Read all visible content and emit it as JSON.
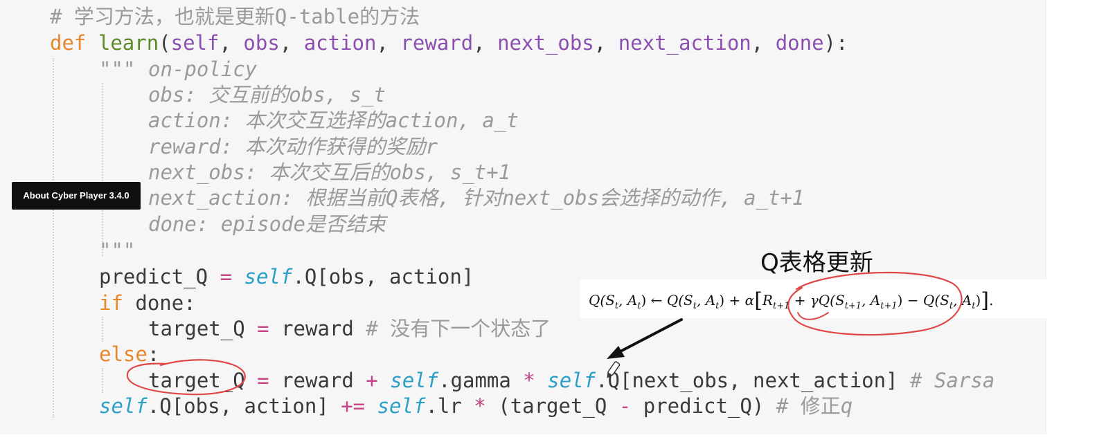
{
  "code": {
    "comment_header": "# 学习方法，也就是更新Q-table的方法",
    "def_line": {
      "def_kw": "def",
      "fn_name": "learn",
      "open": "(",
      "params": [
        "self",
        "obs",
        "action",
        "reward",
        "next_obs",
        "next_action",
        "done"
      ],
      "sep": ", ",
      "close": "):"
    },
    "docstring_quote": "\"\"\"",
    "docstring_lines": [
      "on-policy",
      "obs: 交互前的obs, s_t",
      "action: 本次交互选择的action, a_t",
      "reward: 本次动作获得的奖励r",
      "next_obs: 本次交互后的obs, s_t+1",
      "next_action: 根据当前Q表格, 针对next_obs会选择的动作, a_t+1",
      "done: episode是否结束"
    ],
    "line_predict": {
      "lhs": "predict_Q",
      "eq": " = ",
      "self": "self",
      "rest": ".Q[obs, action]"
    },
    "line_if": {
      "kw": "if",
      "rest": " done:"
    },
    "line_target1": {
      "lhs": "target_Q",
      "eq": " = ",
      "rhs": "reward ",
      "comment": "# 没有下一个状态了"
    },
    "line_else": {
      "kw": "else",
      "rest": ":"
    },
    "line_target2": {
      "lhs": "target_Q",
      "eq": " = ",
      "p1": "reward ",
      "plus": "+",
      "sp": " ",
      "self1": "self",
      "p2": ".gamma ",
      "mul": "*",
      "self2": "self",
      "p3": ".Q[next_obs, next_action] ",
      "comment": "# Sarsa"
    },
    "line_update": {
      "self1": "self",
      "p1": ".Q[obs, action] ",
      "pluseq": "+=",
      "sp": " ",
      "self2": "self",
      "p2": ".lr ",
      "mul": "*",
      "p3": " (target_Q ",
      "minus": "-",
      "p4": " predict_Q) ",
      "comment_hash": "# 修正",
      "comment_q": "q"
    }
  },
  "tooltip": {
    "label": "About Cyber Player 3.4.0"
  },
  "annotation": {
    "title": "Q表格更新",
    "formula": {
      "lhs": "Q(S",
      "t": "t",
      "comma_a": ", A",
      "rparen": ")",
      "arrow": " ← ",
      "q2": "Q(S",
      "plus_alpha": " + α",
      "lbr": "[",
      "r": "R",
      "t1": "t+1",
      "plus_gamma": " + γQ(S",
      "minus": " − Q(S",
      "rbr": "]",
      "dot": "."
    }
  },
  "colors": {
    "background": "#f6f6f6",
    "keyword": "#e8862c",
    "function": "#5f8a2a",
    "param": "#8a4fb0",
    "self": "#2aa0c8",
    "operator": "#c84488",
    "comment": "#9a9a9a",
    "ink_red": "#e04848"
  }
}
